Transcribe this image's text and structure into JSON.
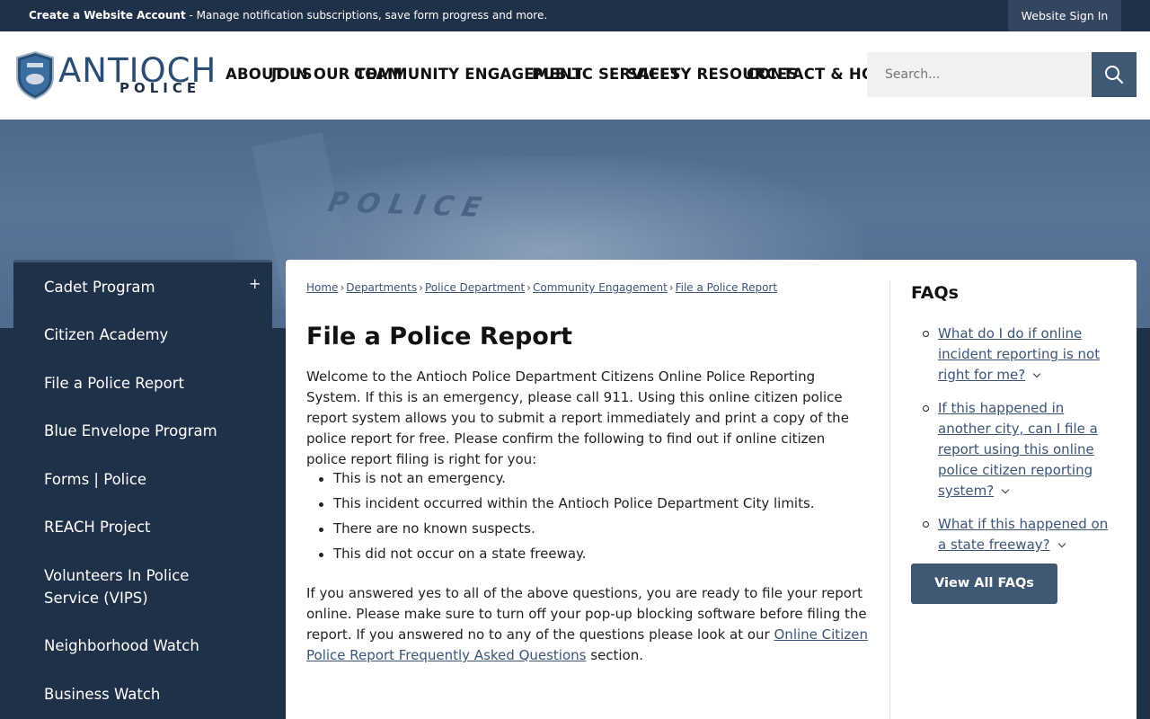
{
  "topbar": {
    "account_bold": "Create a Website Account",
    "account_rest": " - Manage notification subscriptions, save form progress and more.",
    "signin": "Website Sign In"
  },
  "logo": {
    "word": "ANTIOCH",
    "sub": "POLICE",
    "badge_text": "ANTIOCH POLICE"
  },
  "nav": [
    {
      "label": "ABOUT US"
    },
    {
      "label": "JOIN OUR TEAM"
    },
    {
      "label": "COMMUNITY ENGAGEMENT"
    },
    {
      "label": "PUBLIC SERVICES"
    },
    {
      "label": "SAFETY RESOURCES"
    },
    {
      "label": "CONTACT & HOURS"
    }
  ],
  "search": {
    "placeholder": "Search..."
  },
  "hero": {
    "text": "POLICE"
  },
  "sidebar": {
    "items": [
      {
        "label": "Cadet Program"
      },
      {
        "label": "Citizen Academy"
      },
      {
        "label": "File a Police Report"
      },
      {
        "label": "Blue Envelope Program"
      },
      {
        "label": "Forms | Police"
      },
      {
        "label": "REACH Project"
      },
      {
        "label": "Volunteers In Police Service (VIPS)"
      },
      {
        "label": "Neighborhood Watch"
      },
      {
        "label": "Business Watch"
      }
    ],
    "expand_symbol": "+"
  },
  "breadcrumb": [
    {
      "label": "Home"
    },
    {
      "label": "Departments"
    },
    {
      "label": "Police Department"
    },
    {
      "label": "Community Engagement"
    },
    {
      "label": "File a Police Report"
    }
  ],
  "breadcrumb_sep": "›",
  "main": {
    "title": "File a Police Report",
    "intro": "Welcome to the Antioch Police Department Citizens Online Police Reporting System. If this is an emergency, please call 911. Using this online citizen police report system allows you to submit a report immediately and print a copy of the police report for free. Please confirm the following to find out if online citizen police report filing is right for you:",
    "bullets": [
      "This is not an emergency.",
      "This incident occurred within the Antioch Police Department City limits.",
      "There are no known suspects.",
      "This did not occur on a state freeway."
    ],
    "outro_before": "If you answered yes to all of the above questions, you are ready to file your report online. Please make sure to turn off your pop-up blocking software before filing the report. If you answered no to any of the questions please look at our ",
    "outro_link": "Online Citizen Police Report Frequently Asked Questions",
    "outro_after": " section."
  },
  "faqs": {
    "title": "FAQs",
    "items": [
      {
        "label": "What do I do if online incident reporting is not right for me?"
      },
      {
        "label": "If this happened in another city, can I file a report using this online police citizen reporting system?"
      },
      {
        "label": "What if this happened on a state freeway?"
      }
    ],
    "button": "View All FAQs"
  }
}
